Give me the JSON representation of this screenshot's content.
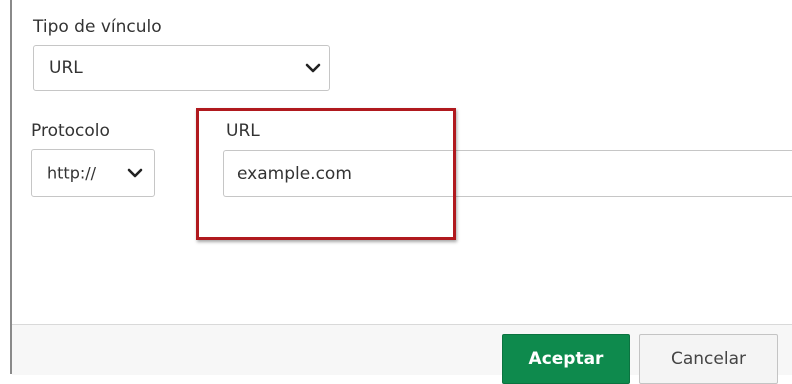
{
  "link_type": {
    "label": "Tipo de vínculo",
    "selected": "URL"
  },
  "protocol": {
    "label": "Protocolo",
    "selected": "http://"
  },
  "url": {
    "label": "URL",
    "value": "example.com"
  },
  "footer": {
    "ok_label": "Aceptar",
    "cancel_label": "Cancelar"
  },
  "colors": {
    "highlight": "#b0191e",
    "ok_button": "#0e8a4d"
  },
  "icons": {
    "dropdown": "chevron-down-icon"
  }
}
